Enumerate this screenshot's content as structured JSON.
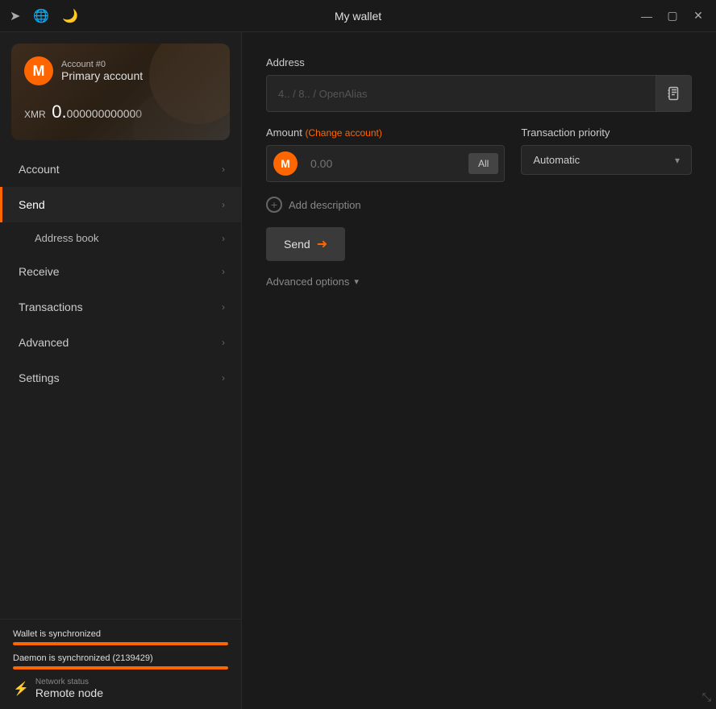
{
  "titlebar": {
    "title": "My wallet",
    "icons": {
      "arrow_icon": "➤",
      "globe_icon": "🌐",
      "moon_icon": "🌙"
    },
    "controls": {
      "minimize": "—",
      "maximize": "▢",
      "close": "✕"
    }
  },
  "sidebar": {
    "account_card": {
      "account_number": "Account #0",
      "account_name": "Primary account",
      "currency": "XMR",
      "amount_integer": "0.",
      "amount_decimal": "000000000000"
    },
    "nav_items": [
      {
        "id": "account",
        "label": "Account",
        "active": false
      },
      {
        "id": "send",
        "label": "Send",
        "active": true
      },
      {
        "id": "address-book",
        "label": "Address book",
        "sub": true
      },
      {
        "id": "receive",
        "label": "Receive",
        "active": false
      },
      {
        "id": "transactions",
        "label": "Transactions",
        "active": false
      },
      {
        "id": "advanced",
        "label": "Advanced",
        "active": false
      },
      {
        "id": "settings",
        "label": "Settings",
        "active": false
      }
    ],
    "footer": {
      "wallet_sync_label": "Wallet is synchronized",
      "wallet_sync_percent": 100,
      "daemon_sync_label": "Daemon is synchronized (2139429)",
      "daemon_sync_percent": 100,
      "network_status_label": "Network status",
      "network_status_value": "Remote node"
    }
  },
  "content": {
    "address_label": "Address",
    "address_placeholder": "4.. / 8.. / OpenAlias",
    "address_book_icon": "📋",
    "amount_label": "Amount",
    "change_account_label": "(Change account)",
    "amount_placeholder": "0.00",
    "all_button_label": "All",
    "transaction_priority_label": "Transaction priority",
    "priority_value": "Automatic",
    "add_description_label": "Add description",
    "send_button_label": "Send",
    "advanced_options_label": "Advanced options"
  }
}
